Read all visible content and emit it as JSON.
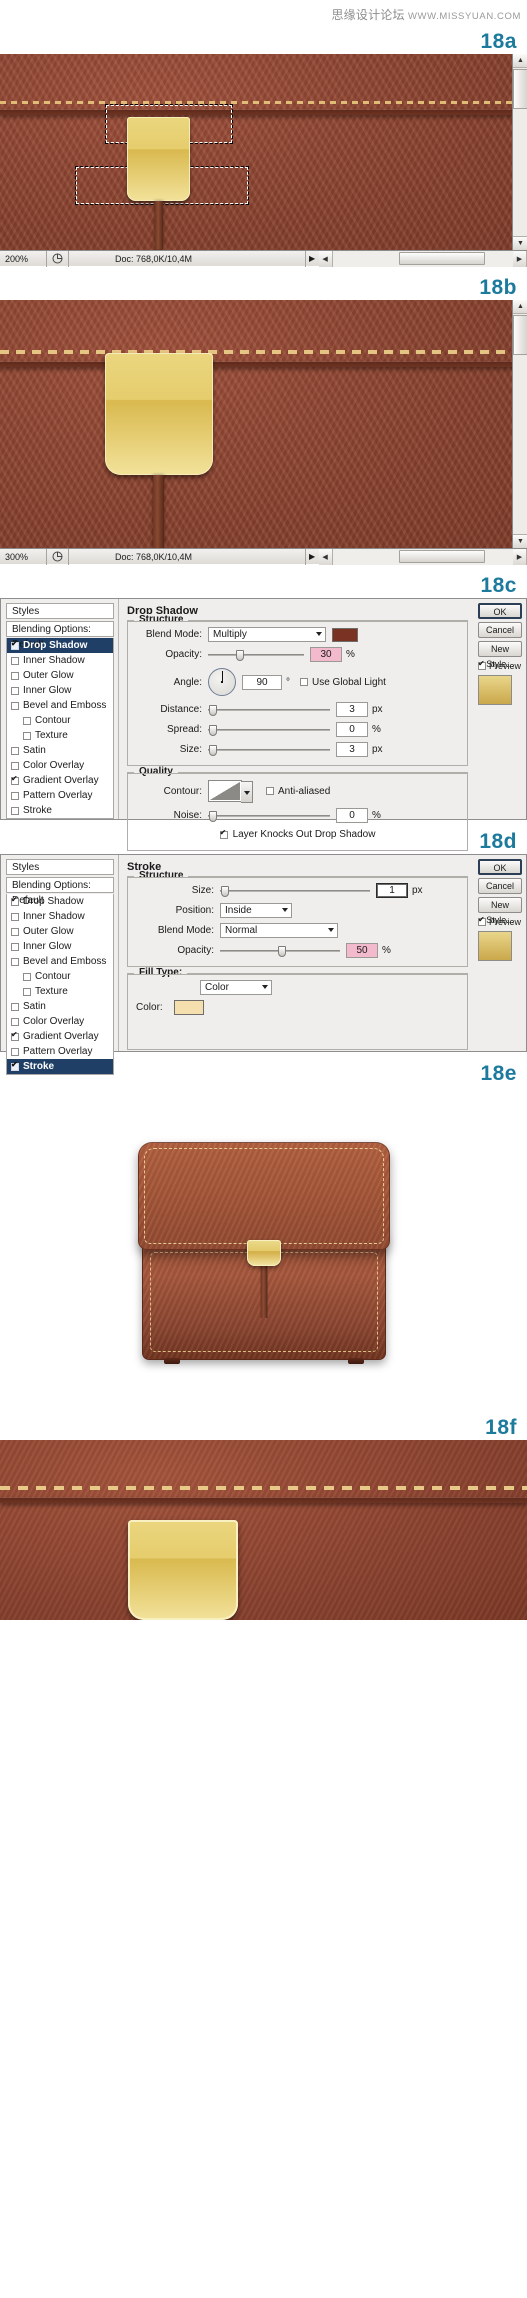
{
  "watermark": {
    "cn": "思缘设计论坛",
    "url": "WWW.MISSYUAN.COM"
  },
  "steps": {
    "a": "18a",
    "b": "18b",
    "c": "18c",
    "d": "18d",
    "e": "18e",
    "f": "18f"
  },
  "doc_a": {
    "zoom": "200%",
    "doc_info": "Doc: 768,0K/10,4M",
    "play_arrow": "▶",
    "left_arrow": "◀",
    "right_arrow": "▶",
    "up_arrow": "▲",
    "down_arrow": "▼"
  },
  "doc_b": {
    "zoom": "300%",
    "doc_info": "Doc: 768,0K/10,4M",
    "play_arrow": "▶",
    "left_arrow": "◀",
    "right_arrow": "▶",
    "up_arrow": "▲",
    "down_arrow": "▼"
  },
  "dialog_drop_shadow": {
    "styles_header": "Styles",
    "blending_options": "Blending Options: Default",
    "styles": [
      {
        "label": "Drop Shadow",
        "checked": true,
        "selected": true,
        "indent": false
      },
      {
        "label": "Inner Shadow",
        "checked": false,
        "selected": false,
        "indent": false
      },
      {
        "label": "Outer Glow",
        "checked": false,
        "selected": false,
        "indent": false
      },
      {
        "label": "Inner Glow",
        "checked": false,
        "selected": false,
        "indent": false
      },
      {
        "label": "Bevel and Emboss",
        "checked": false,
        "selected": false,
        "indent": false
      },
      {
        "label": "Contour",
        "checked": false,
        "selected": false,
        "indent": true
      },
      {
        "label": "Texture",
        "checked": false,
        "selected": false,
        "indent": true
      },
      {
        "label": "Satin",
        "checked": false,
        "selected": false,
        "indent": false
      },
      {
        "label": "Color Overlay",
        "checked": false,
        "selected": false,
        "indent": false
      },
      {
        "label": "Gradient Overlay",
        "checked": true,
        "selected": false,
        "indent": false
      },
      {
        "label": "Pattern Overlay",
        "checked": false,
        "selected": false,
        "indent": false
      },
      {
        "label": "Stroke",
        "checked": false,
        "selected": false,
        "indent": false
      }
    ],
    "panel_title": "Drop Shadow",
    "structure_legend": "Structure",
    "quality_legend": "Quality",
    "blend_mode_label": "Blend Mode:",
    "blend_mode_value": "Multiply",
    "blend_color": "#7a3322",
    "opacity_label": "Opacity:",
    "opacity_value": "30",
    "opacity_unit": "%",
    "angle_label": "Angle:",
    "angle_value": "90",
    "angle_unit": "°",
    "use_global_light": "Use Global Light",
    "distance_label": "Distance:",
    "distance_value": "3",
    "distance_unit": "px",
    "spread_label": "Spread:",
    "spread_value": "0",
    "spread_unit": "%",
    "size_label": "Size:",
    "size_value": "3",
    "size_unit": "px",
    "contour_label": "Contour:",
    "anti_aliased": "Anti-aliased",
    "noise_label": "Noise:",
    "noise_value": "0",
    "noise_unit": "%",
    "knockout": "Layer Knocks Out Drop Shadow",
    "buttons": {
      "ok": "OK",
      "cancel": "Cancel",
      "new_style": "New Style...",
      "preview": "Preview"
    }
  },
  "dialog_stroke": {
    "styles_header": "Styles",
    "blending_options": "Blending Options: Default",
    "styles": [
      {
        "label": "Drop Shadow",
        "checked": true,
        "selected": false,
        "indent": false
      },
      {
        "label": "Inner Shadow",
        "checked": false,
        "selected": false,
        "indent": false
      },
      {
        "label": "Outer Glow",
        "checked": false,
        "selected": false,
        "indent": false
      },
      {
        "label": "Inner Glow",
        "checked": false,
        "selected": false,
        "indent": false
      },
      {
        "label": "Bevel and Emboss",
        "checked": false,
        "selected": false,
        "indent": false
      },
      {
        "label": "Contour",
        "checked": false,
        "selected": false,
        "indent": true
      },
      {
        "label": "Texture",
        "checked": false,
        "selected": false,
        "indent": true
      },
      {
        "label": "Satin",
        "checked": false,
        "selected": false,
        "indent": false
      },
      {
        "label": "Color Overlay",
        "checked": false,
        "selected": false,
        "indent": false
      },
      {
        "label": "Gradient Overlay",
        "checked": true,
        "selected": false,
        "indent": false
      },
      {
        "label": "Pattern Overlay",
        "checked": false,
        "selected": false,
        "indent": false
      },
      {
        "label": "Stroke",
        "checked": true,
        "selected": true,
        "indent": false
      }
    ],
    "panel_title": "Stroke",
    "structure_legend": "Structure",
    "size_label": "Size:",
    "size_value": "1",
    "size_unit": "px",
    "position_label": "Position:",
    "position_value": "Inside",
    "blend_mode_label": "Blend Mode:",
    "blend_mode_value": "Normal",
    "opacity_label": "Opacity:",
    "opacity_value": "50",
    "opacity_unit": "%",
    "fill_type_label": "Fill Type:",
    "fill_type_value": "Color",
    "color_label": "Color:",
    "color_value": "#f6dfae",
    "buttons": {
      "ok": "OK",
      "cancel": "Cancel",
      "new_style": "New Style...",
      "preview": "Preview"
    }
  }
}
